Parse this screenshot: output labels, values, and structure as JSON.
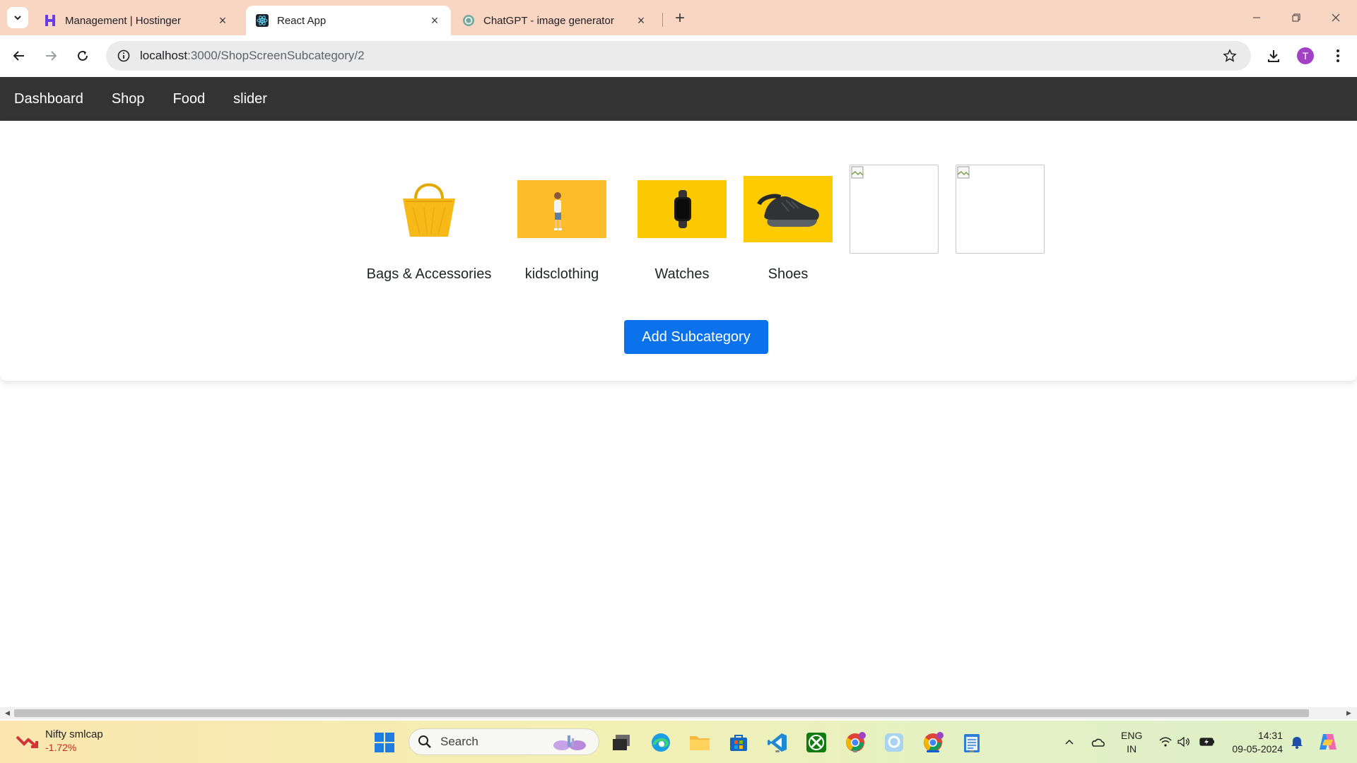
{
  "browser": {
    "tabs": [
      {
        "title": "Management | Hostinger",
        "active": false
      },
      {
        "title": "React App",
        "active": true
      },
      {
        "title": "ChatGPT - image generator",
        "active": false
      }
    ],
    "address": {
      "host": "localhost",
      "path": ":3000/ShopScreenSubcategory/2"
    },
    "profile_initial": "T"
  },
  "navbar": {
    "links": [
      "Dashboard",
      "Shop",
      "Food",
      "slider"
    ]
  },
  "subcategories": [
    {
      "label": "Bags & Accessories",
      "image": "yellow-handbag"
    },
    {
      "label": "kidsclothing",
      "image": "child-on-yellow"
    },
    {
      "label": "Watches",
      "image": "smartwatch-on-yellow"
    },
    {
      "label": "Shoes",
      "image": "sneaker-on-yellow"
    },
    {
      "label": "",
      "image": "broken-image"
    },
    {
      "label": "",
      "image": "broken-image"
    }
  ],
  "add_button": "Add Subcategory",
  "taskbar": {
    "widget": {
      "name": "Nifty smlcap",
      "change": "-1.72%"
    },
    "search_placeholder": "Search",
    "language": [
      "ENG",
      "IN"
    ],
    "time": "14:31",
    "date": "09-05-2024"
  },
  "colors": {
    "tabstrip": "#f9d5c4",
    "navbar": "#333333",
    "primary_button": "#0b72ec",
    "thumb_yellow": "#fbc02d"
  }
}
